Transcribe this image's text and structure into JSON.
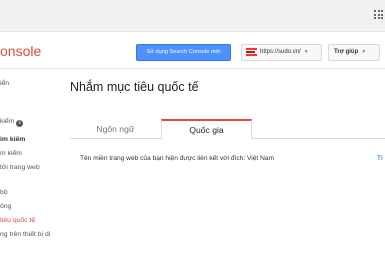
{
  "header": {
    "product_name": "onsole",
    "search_console_button": "Sử dụng Search Console mới",
    "site_selector": "https://sudo.vn/",
    "help_label": "Trợ giúp"
  },
  "sidebar": {
    "items": [
      {
        "label": "iển"
      },
      {
        "label": "kiểm"
      },
      {
        "label": "ìm kiếm"
      },
      {
        "label": "m kiếm"
      },
      {
        "label": "tới trang web"
      },
      {
        "label": "bộ"
      },
      {
        "label": "ông"
      },
      {
        "label": "tiêu quốc tế"
      },
      {
        "label": "ng trên thiết bị di"
      }
    ]
  },
  "main": {
    "title": "Nhắm mục tiêu quốc tế",
    "tabs": [
      {
        "label": "Ngôn ngữ"
      },
      {
        "label": "Quốc gia"
      }
    ],
    "description": "Tên miền trang web của bạn hiện được liên kết với đích: Việt Nam",
    "edge_link": "Tì"
  },
  "colors": {
    "accent": "#dd4b39",
    "primary_button": "#4d90fe",
    "link": "#1155cc"
  }
}
